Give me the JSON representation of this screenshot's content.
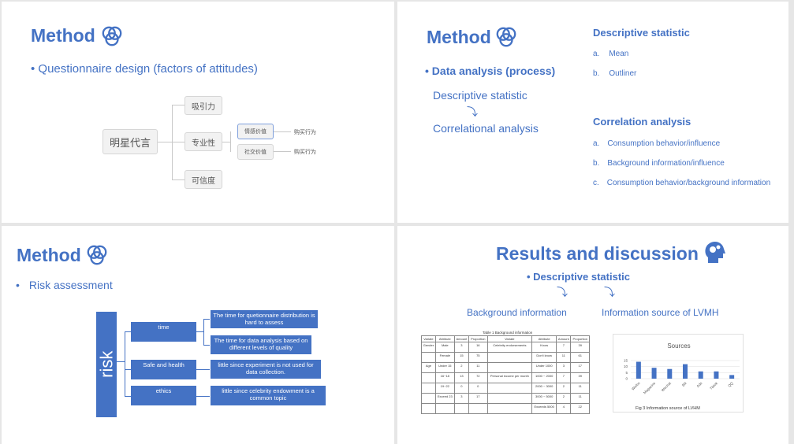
{
  "slide1": {
    "title": "Method",
    "icon": "venn-icon",
    "bullet": "• Questionnaire design (factors of attitudes)",
    "root": "明星代言",
    "branches": [
      "吸引力",
      "专业性",
      "可信度"
    ],
    "sub": [
      "情感价值",
      "社交价值"
    ],
    "leaf": [
      "购买行为",
      "购买行为"
    ]
  },
  "slide2": {
    "title": "Method",
    "icon": "venn-icon",
    "bullet": "• Data analysis (process)",
    "step1": "Descriptive statistic",
    "step2": "Correlational analysis",
    "desc_heading": "Descriptive statistic",
    "desc_items": [
      {
        "m": "a.",
        "t": "Mean"
      },
      {
        "m": "b.",
        "t": "Outliner"
      }
    ],
    "corr_heading": "Correlation analysis",
    "corr_items": [
      {
        "m": "a.",
        "t": "Consumption behavior/influence"
      },
      {
        "m": "b.",
        "t": "Background information/influence"
      },
      {
        "m": "c.",
        "t": "Consumption behavior/background information"
      }
    ]
  },
  "slide3": {
    "title": "Method",
    "icon": "venn-icon",
    "bullet_mark": "•",
    "bullet": "Risk assessment",
    "root": "risk",
    "categories": [
      "time",
      "Safe and health",
      "ethics"
    ],
    "details": [
      "The time for quetionnaire distribution is hard to assess",
      "The time for data analysis based on different levels of quality",
      "little since experiment is not used for data collection.",
      "little since celebrity endowment is a common topic"
    ]
  },
  "slide4": {
    "title": "Results and discussion",
    "icon": "head-gears-icon",
    "bullet": "• Descriptive statistic",
    "left_label": "Background information",
    "right_label": "Information source of LVMH",
    "table_caption": "Table 1 Background information",
    "table_headers": [
      "Variate",
      "Attribute",
      "Amount",
      "Proportion",
      "Variate",
      "Attribute",
      "Amount",
      "Proportion"
    ],
    "table_rows": [
      [
        "Gender",
        "Male",
        "3",
        "16",
        "Celebrity endorsements",
        "Know",
        "7",
        "39"
      ],
      [
        "",
        "Female",
        "15",
        "75",
        "",
        "Don't know",
        "11",
        "61"
      ],
      [
        "Age",
        "Under 15",
        "2",
        "11",
        "",
        "Under 1000",
        "3",
        "17"
      ],
      [
        "",
        "16~18",
        "13",
        "72",
        "Personal income per month",
        "1000 ~ 2000",
        "7",
        "39"
      ],
      [
        "",
        "19~22",
        "0",
        "0",
        "",
        "2000 ~ 3000",
        "2",
        "11"
      ],
      [
        "",
        "Exceed 23",
        "3",
        "17",
        "",
        "3000 ~ 5000",
        "2",
        "11"
      ],
      [
        "",
        "",
        "",
        "",
        "",
        "Exceeds 5000",
        "4",
        "22"
      ]
    ],
    "fig_caption": "Fig 3 Information source of LVHM"
  },
  "chart_data": {
    "type": "bar",
    "title": "Sources",
    "categories": [
      "Weibo",
      "Magazine",
      "Wechat",
      "Bili",
      "Ads",
      "Tiktok",
      "QQ"
    ],
    "values": [
      14,
      9,
      8,
      12,
      6,
      6,
      3
    ],
    "yticks": [
      0,
      5,
      10,
      15
    ],
    "ylim": [
      0,
      15
    ],
    "grid": true,
    "color": "#4472c4"
  }
}
